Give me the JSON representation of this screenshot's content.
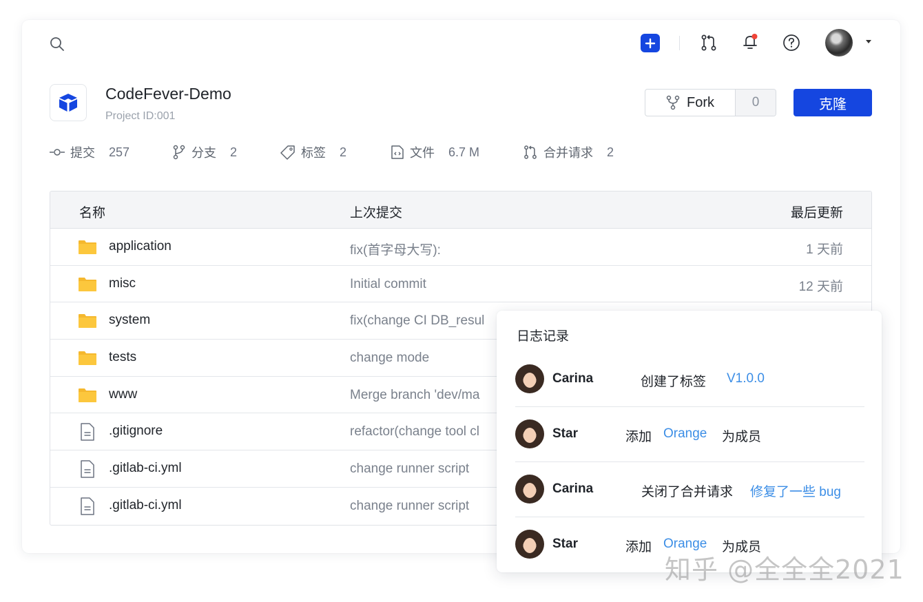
{
  "topbar": {
    "icons": [
      "search-icon",
      "plus-icon",
      "merge-request-icon",
      "bell-icon",
      "help-icon",
      "avatar",
      "caret-down-icon"
    ],
    "notification_dot_color": "#f04438"
  },
  "project": {
    "name": "CodeFever-Demo",
    "id_label": "Project ID:001",
    "fork_label": "Fork",
    "fork_count": "0",
    "clone_label": "克隆",
    "accent_color": "#1546e0"
  },
  "stats": [
    {
      "icon": "commit-icon",
      "label": "提交",
      "value": "257"
    },
    {
      "icon": "branch-icon",
      "label": "分支",
      "value": "2"
    },
    {
      "icon": "tag-icon",
      "label": "标签",
      "value": "2"
    },
    {
      "icon": "file-icon",
      "label": "文件",
      "value": "6.7 M"
    },
    {
      "icon": "merge-request-icon",
      "label": "合并请求",
      "value": "2"
    }
  ],
  "table": {
    "headers": [
      "名称",
      "上次提交",
      "最后更新"
    ],
    "rows": [
      {
        "type": "folder",
        "name": "application",
        "commit": "fix(首字母大写):",
        "time": "1 天前"
      },
      {
        "type": "folder",
        "name": "misc",
        "commit": "Initial commit",
        "time": "12 天前"
      },
      {
        "type": "folder",
        "name": "system",
        "commit": "fix(change CI DB_resul",
        "time": ""
      },
      {
        "type": "folder",
        "name": "tests",
        "commit": "change mode",
        "time": ""
      },
      {
        "type": "folder",
        "name": "www",
        "commit": "Merge branch 'dev/ma",
        "time": ""
      },
      {
        "type": "file",
        "name": ".gitignore",
        "commit": "refactor(change tool cl",
        "time": ""
      },
      {
        "type": "file",
        "name": ".gitlab-ci.yml",
        "commit": "change runner script",
        "time": ""
      },
      {
        "type": "file",
        "name": ".gitlab-ci.yml",
        "commit": "change runner script",
        "time": ""
      }
    ]
  },
  "log_popup": {
    "title": "日志记录",
    "entries": [
      {
        "user": "Carina",
        "action": "创建了标签",
        "link": "V1.0.0",
        "tail": ""
      },
      {
        "user": "Star",
        "action": "添加",
        "link": "Orange",
        "tail": "为成员"
      },
      {
        "user": "Carina",
        "action": "关闭了合并请求",
        "link": "修复了一些 bug",
        "tail": ""
      },
      {
        "user": "Star",
        "action": "添加",
        "link": "Orange",
        "tail": "为成员"
      }
    ]
  },
  "watermark": "知乎 @全全全2021"
}
